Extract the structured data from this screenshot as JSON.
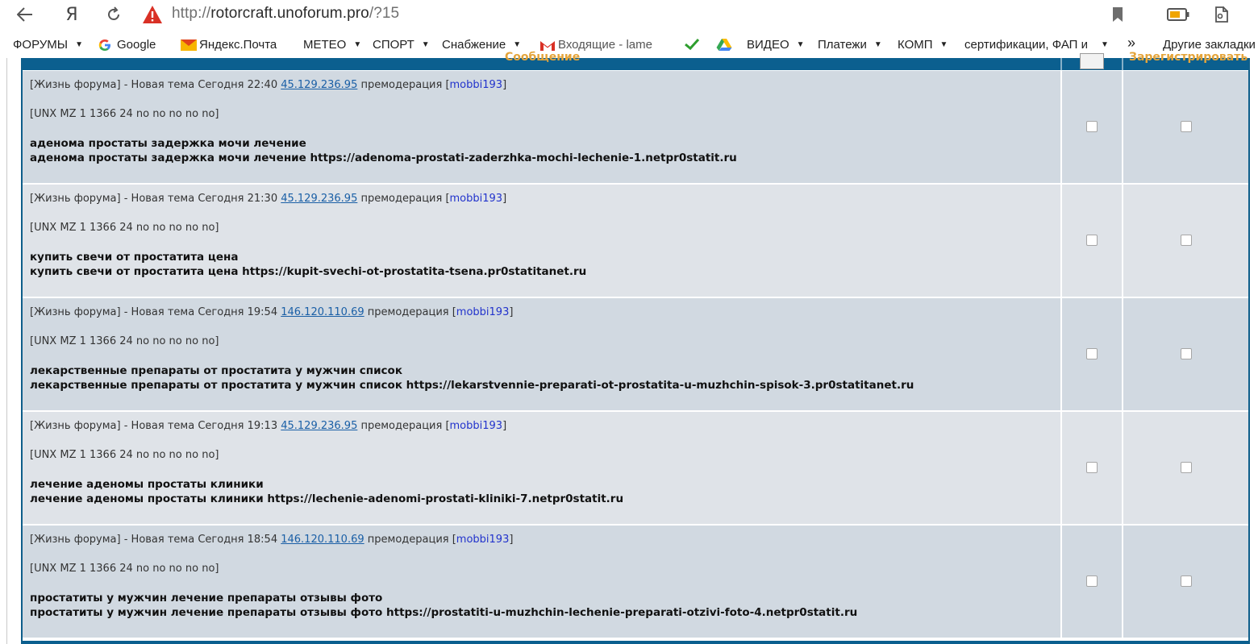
{
  "browser": {
    "url_scheme": "http://",
    "url_host": "rotorcraft.unoforum.pro",
    "url_path": "/?15",
    "yandex_glyph": "Я"
  },
  "bookmarks": [
    {
      "label": "ФОРУМЫ",
      "folder": true
    },
    {
      "label": "Google",
      "folder": false
    },
    {
      "label": "Яндекс.Почта",
      "folder": false
    },
    {
      "label": "МЕТЕО",
      "folder": true
    },
    {
      "label": "СПОРТ",
      "folder": true
    },
    {
      "label": "Снабжение",
      "folder": true
    },
    {
      "label": "Входящие - lame",
      "folder": false
    },
    {
      "label": "ВИДЕО",
      "folder": true
    },
    {
      "label": "Платежи",
      "folder": true
    },
    {
      "label": "КОМП",
      "folder": true
    },
    {
      "label": "сертификации, ФАП и",
      "folder": true
    },
    {
      "label": "»",
      "folder": false
    },
    {
      "label": "Другие закладки",
      "folder": false
    }
  ],
  "table_header": {
    "col_message": "Сообщение",
    "col_moderate": "Зарегистрировать"
  },
  "rows": [
    {
      "meta_prefix": "[Жизнь форума] - Новая тема Сегодня 22:40 ",
      "ip": "45.129.236.95",
      "meta_mid": " премодерация [",
      "user": "mobbi193",
      "meta_end": "]",
      "client": "[UNX MZ 1 1366 24 no no no no no]",
      "title": "аденома простаты задержка мочи лечение",
      "body": "аденома простаты задержка мочи лечение https://adenoma-prostati-zaderzhka-mochi-lechenie-1.netpr0statit.ru"
    },
    {
      "meta_prefix": "[Жизнь форума] - Новая тема Сегодня 21:30 ",
      "ip": "45.129.236.95",
      "meta_mid": " премодерация [",
      "user": "mobbi193",
      "meta_end": "]",
      "client": "[UNX MZ 1 1366 24 no no no no no]",
      "title": "купить свечи от простатита цена",
      "body": "купить свечи от простатита цена https://kupit-svechi-ot-prostatita-tsena.pr0statitanet.ru"
    },
    {
      "meta_prefix": "[Жизнь форума] - Новая тема Сегодня 19:54 ",
      "ip": "146.120.110.69",
      "meta_mid": " премодерация [",
      "user": "mobbi193",
      "meta_end": "]",
      "client": "[UNX MZ 1 1366 24 no no no no no]",
      "title": "лекарственные препараты от простатита у мужчин список",
      "body": "лекарственные препараты от простатита у мужчин список https://lekarstvennie-preparati-ot-prostatita-u-muzhchin-spisok-3.pr0statitanet.ru"
    },
    {
      "meta_prefix": "[Жизнь форума] - Новая тема Сегодня 19:13 ",
      "ip": "45.129.236.95",
      "meta_mid": " премодерация [",
      "user": "mobbi193",
      "meta_end": "]",
      "client": "[UNX MZ 1 1366 24 no no no no no]",
      "title": "лечение аденомы простаты клиники",
      "body": "лечение аденомы простаты клиники https://lechenie-adenomi-prostati-kliniki-7.netpr0statit.ru"
    },
    {
      "meta_prefix": "[Жизнь форума] - Новая тема Сегодня 18:54 ",
      "ip": "146.120.110.69",
      "meta_mid": " премодерация [",
      "user": "mobbi193",
      "meta_end": "]",
      "client": "[UNX MZ 1 1366 24 no no no no no]",
      "title": "простатиты у мужчин лечение препараты отзывы фото",
      "body": "простатиты у мужчин лечение препараты отзывы фото https://prostatiti-u-muzhchin-lechenie-preparati-otzivi-foto-4.netpr0statit.ru"
    }
  ],
  "colors": {
    "header_blue": "#0b5f8f",
    "header_text": "#e4a43a",
    "row_odd": "#d1d9e1",
    "row_even": "#dfe3e8",
    "ip_link": "#1a5fa6",
    "user_link": "#2233cc"
  }
}
